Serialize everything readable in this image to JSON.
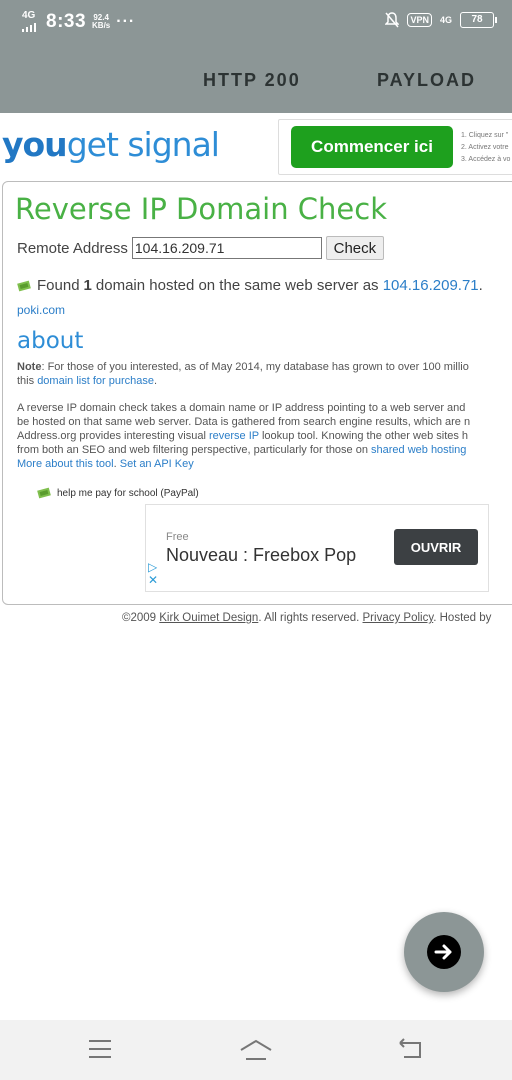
{
  "status_bar": {
    "network_left": "4G",
    "time": "8:33",
    "speed_value": "92.4",
    "speed_unit": "KB/s",
    "more": "···",
    "vpn": "VPN",
    "network_right": "4G",
    "battery": "78"
  },
  "app_tabs": [
    "HTTP 200",
    "PAYLOAD"
  ],
  "site": {
    "logo_you": "you",
    "logo_rest": "get signal",
    "top_ad": {
      "button": "Commencer ici",
      "steps": [
        "1. Cliquez sur \"",
        "2. Activez votre",
        "3. Accédez à vo"
      ]
    },
    "title": "Reverse IP Domain Check",
    "form": {
      "label": "Remote Address",
      "value": "104.16.209.71",
      "button": "Check"
    },
    "result": {
      "prefix": "Found",
      "count": "1",
      "middle": "domain hosted on the same web server as",
      "ip": "104.16.209.71",
      "suffix": "."
    },
    "domains": [
      "poki.com"
    ],
    "about_heading": "about",
    "note": {
      "label": "Note",
      "text": ": For those of you interested, as of May 2014, my database has grown to over 100 millio",
      "line2_prefix": "this ",
      "link": "domain list for purchase",
      "line2_suffix": "."
    },
    "paragraph": {
      "line1": "A reverse IP domain check takes a domain name or IP address pointing to a web server and",
      "line2": "be hosted on that same web server. Data is gathered from search engine results, which are n",
      "line3_prefix": "Address.org provides interesting visual ",
      "line3_link": "reverse IP",
      "line3_suffix": " lookup tool. Knowing the other web sites h",
      "line4_prefix": "from both an SEO and web filtering perspective, particularly for those on ",
      "line4_link": "shared web hosting",
      "line5_link1": "More about this tool",
      "line5_sep": ". ",
      "line5_link2": "Set an API Key"
    },
    "paypal": "help me pay for school (PayPal)",
    "bottom_ad": {
      "label": "Free",
      "title": "Nouveau : Freebox Pop",
      "button": "OUVRIR"
    },
    "footer": {
      "prefix": "©2009 ",
      "author": "Kirk Ouimet Design",
      "middle": ". All rights reserved. ",
      "privacy": "Privacy Policy",
      "suffix": ". Hosted by"
    }
  },
  "colors": {
    "appbar": "#8c9696",
    "title_green": "#49b145",
    "link_blue": "#2b7ec8",
    "ad_green": "#1ea01e"
  },
  "icons": [
    "signal-icon",
    "mute-icon",
    "battery-icon",
    "money-icon",
    "adchoices-icon",
    "arrow-right-icon",
    "menu-icon",
    "home-icon",
    "back-icon"
  ]
}
